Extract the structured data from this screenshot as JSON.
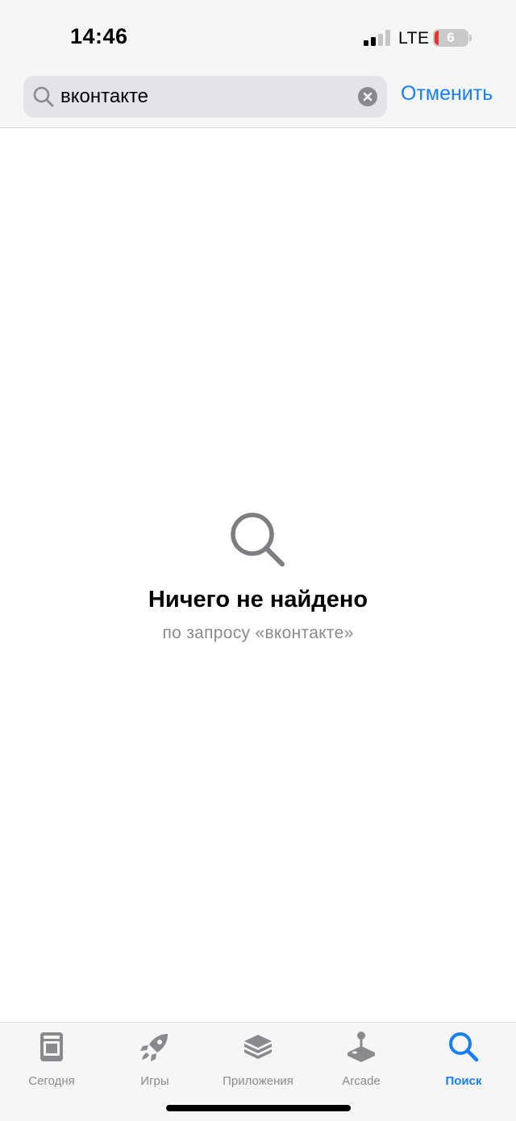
{
  "status_bar": {
    "time": "14:46",
    "network": "LTE",
    "battery_level": "6",
    "battery_color": "#e8322c",
    "signal_bars_filled": 2,
    "signal_bars_total": 4
  },
  "search": {
    "value": "вконтакте",
    "cancel_label": "Отменить",
    "icon": "search-icon",
    "clear_icon": "clear-icon"
  },
  "empty_state": {
    "icon": "search-icon",
    "title": "Ничего не найдено",
    "subtitle": "по запросу «вконтакте»"
  },
  "tab_bar": {
    "active_color": "#157efb",
    "inactive_color": "#8a8a8e",
    "tabs": [
      {
        "label": "Сегодня",
        "icon": "today-icon",
        "active": false
      },
      {
        "label": "Игры",
        "icon": "rocket-icon",
        "active": false
      },
      {
        "label": "Приложения",
        "icon": "layers-icon",
        "active": false
      },
      {
        "label": "Arcade",
        "icon": "joystick-icon",
        "active": false
      },
      {
        "label": "Поиск",
        "icon": "search-icon",
        "active": true
      }
    ]
  }
}
